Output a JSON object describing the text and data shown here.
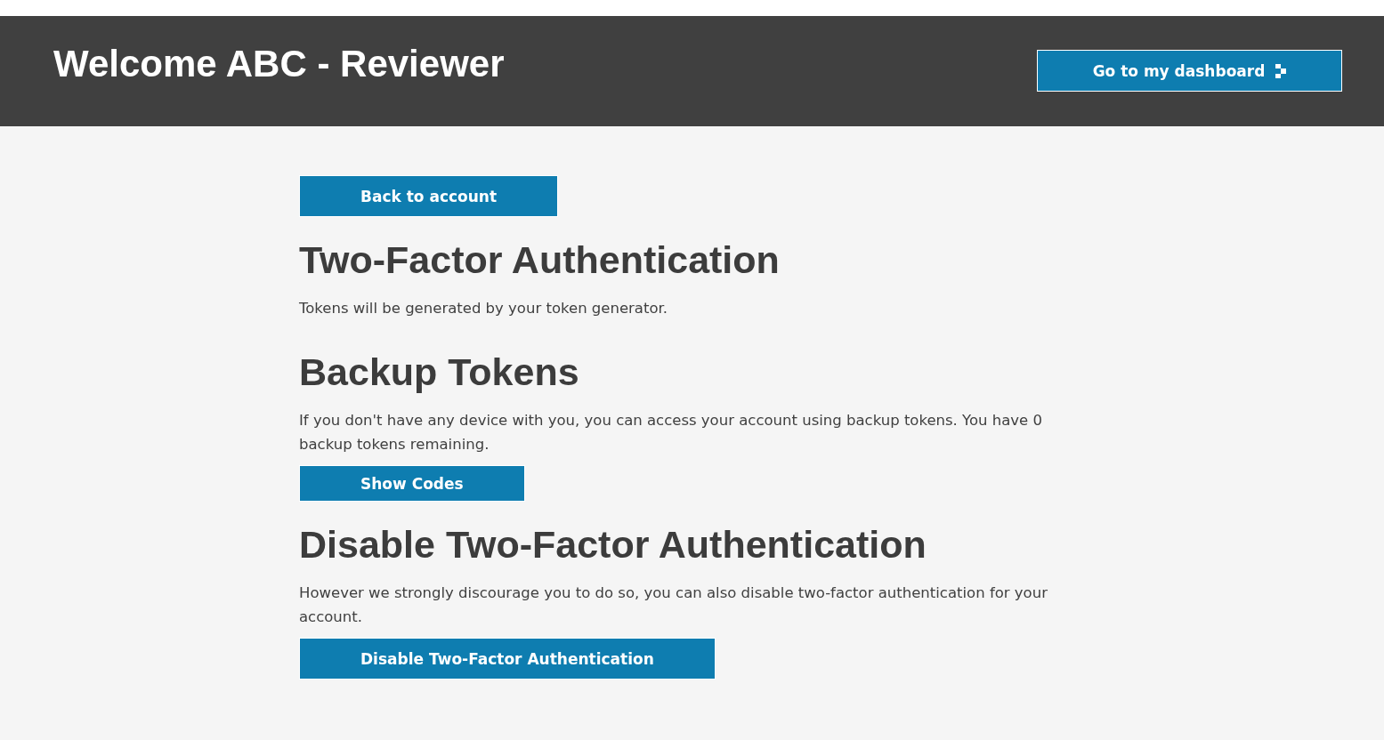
{
  "header": {
    "title": "Welcome ABC - Reviewer",
    "dashboard_button": "Go to my dashboard"
  },
  "content": [
    {
      "kind": "button",
      "label": "Back to account"
    },
    {
      "kind": "heading",
      "text": "Two-Factor Authentication"
    },
    {
      "kind": "paragraph",
      "text": "Tokens will be generated by your token generator."
    },
    {
      "kind": "heading",
      "text": "Backup Tokens"
    },
    {
      "kind": "paragraph",
      "text": "If you don't have any device with you, you can access your account using backup tokens. You have 0 backup tokens remaining."
    },
    {
      "kind": "button",
      "label": "Show Codes"
    },
    {
      "kind": "heading",
      "text": "Disable Two-Factor Authentication"
    },
    {
      "kind": "paragraph",
      "text": "However we strongly discourage you to do so, you can also disable two-factor authentication for your account."
    },
    {
      "kind": "button",
      "label": "Disable Two-Factor Authentication"
    }
  ]
}
